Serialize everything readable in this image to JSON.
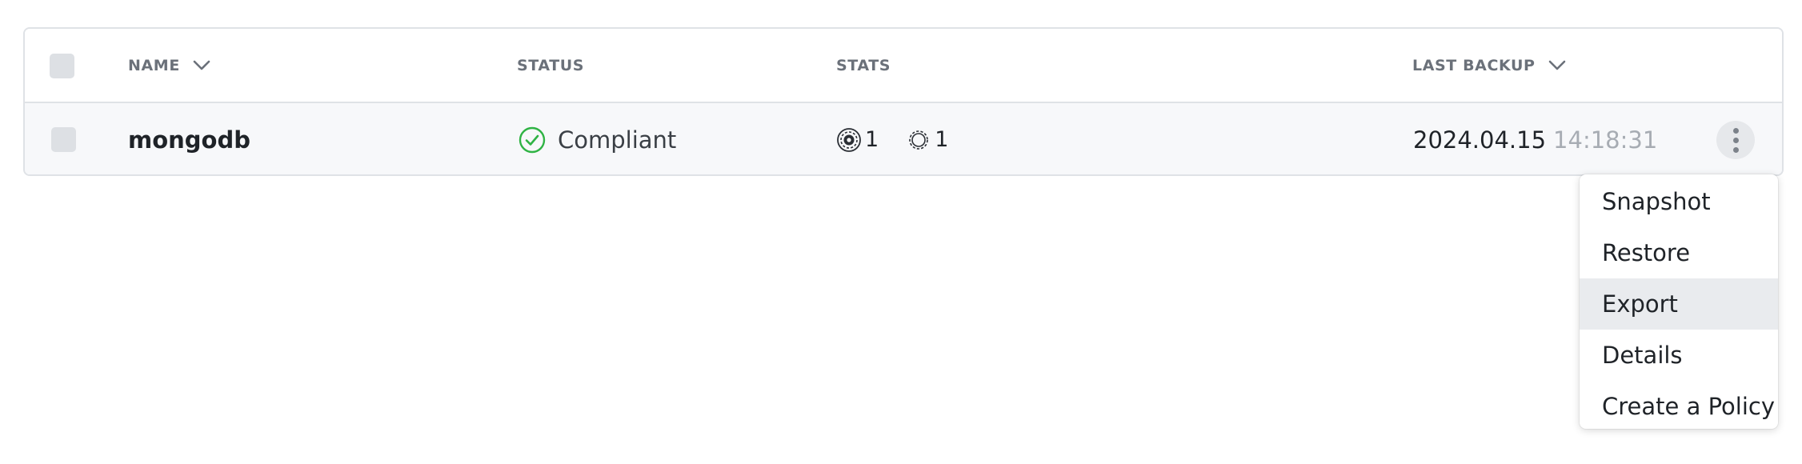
{
  "table": {
    "columns": {
      "name": "NAME",
      "status": "STATUS",
      "stats": "STATS",
      "last_backup": "LAST BACKUP"
    },
    "rows": [
      {
        "name": "mongodb",
        "status": "Compliant",
        "status_color": "#2fb344",
        "stats": [
          {
            "icon": "snapshot-gear-icon",
            "value": "1"
          },
          {
            "icon": "gear-icon",
            "value": "1"
          }
        ],
        "backup_date": "2024.04.15",
        "backup_time": "14:18:31"
      }
    ]
  },
  "menu": {
    "items": [
      {
        "label": "Snapshot"
      },
      {
        "label": "Restore"
      },
      {
        "label": "Export",
        "highlighted": true
      },
      {
        "label": "Details"
      },
      {
        "label": "Create a Policy"
      }
    ]
  }
}
